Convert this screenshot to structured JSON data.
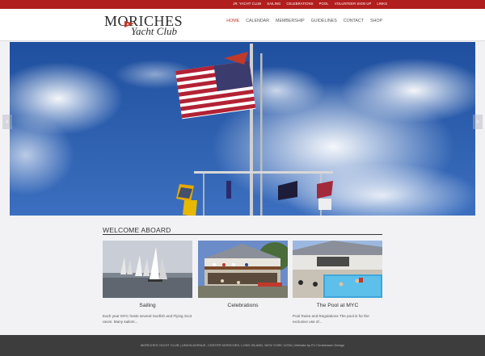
{
  "top_links": [
    "JR. YACHT CLUB",
    "SAILING",
    "CELEBRATIONS",
    "POOL",
    "VOLUNTEER SIGN UP",
    "LINKS"
  ],
  "logo": {
    "main": "MORICHES",
    "sub": "Yacht Club"
  },
  "nav": [
    {
      "label": "HOME",
      "active": true
    },
    {
      "label": "CALENDAR",
      "active": false
    },
    {
      "label": "MEMBERSHIP",
      "active": false
    },
    {
      "label": "GUIDELINES",
      "active": false
    },
    {
      "label": "CONTACT",
      "active": false
    },
    {
      "label": "SHOP",
      "active": false
    }
  ],
  "slider": {
    "prev": "‹",
    "next": "›"
  },
  "welcome": {
    "title": "WELCOME ABOARD",
    "cards": [
      {
        "caption": "Sailing",
        "text": "Each year MYC hosts several Sunfish and Flying Scot races. Many sailors..."
      },
      {
        "caption": "Celebrations",
        "text": ""
      },
      {
        "caption": "The Pool at MYC",
        "text": "Pool Rules and Regulations The pool is for the exclusive use of..."
      }
    ]
  },
  "footer": {
    "text": "MORICHES YACHT CLUB   |   UNION AVENUE, CENTER MORICHES, LONG ISLAND, NEW YORK 11934   |   Website by RJ Christensen Design"
  },
  "colors": {
    "accent": "#b11e1e",
    "sky": "#2a5aa8",
    "footer": "#3d3d3d"
  }
}
